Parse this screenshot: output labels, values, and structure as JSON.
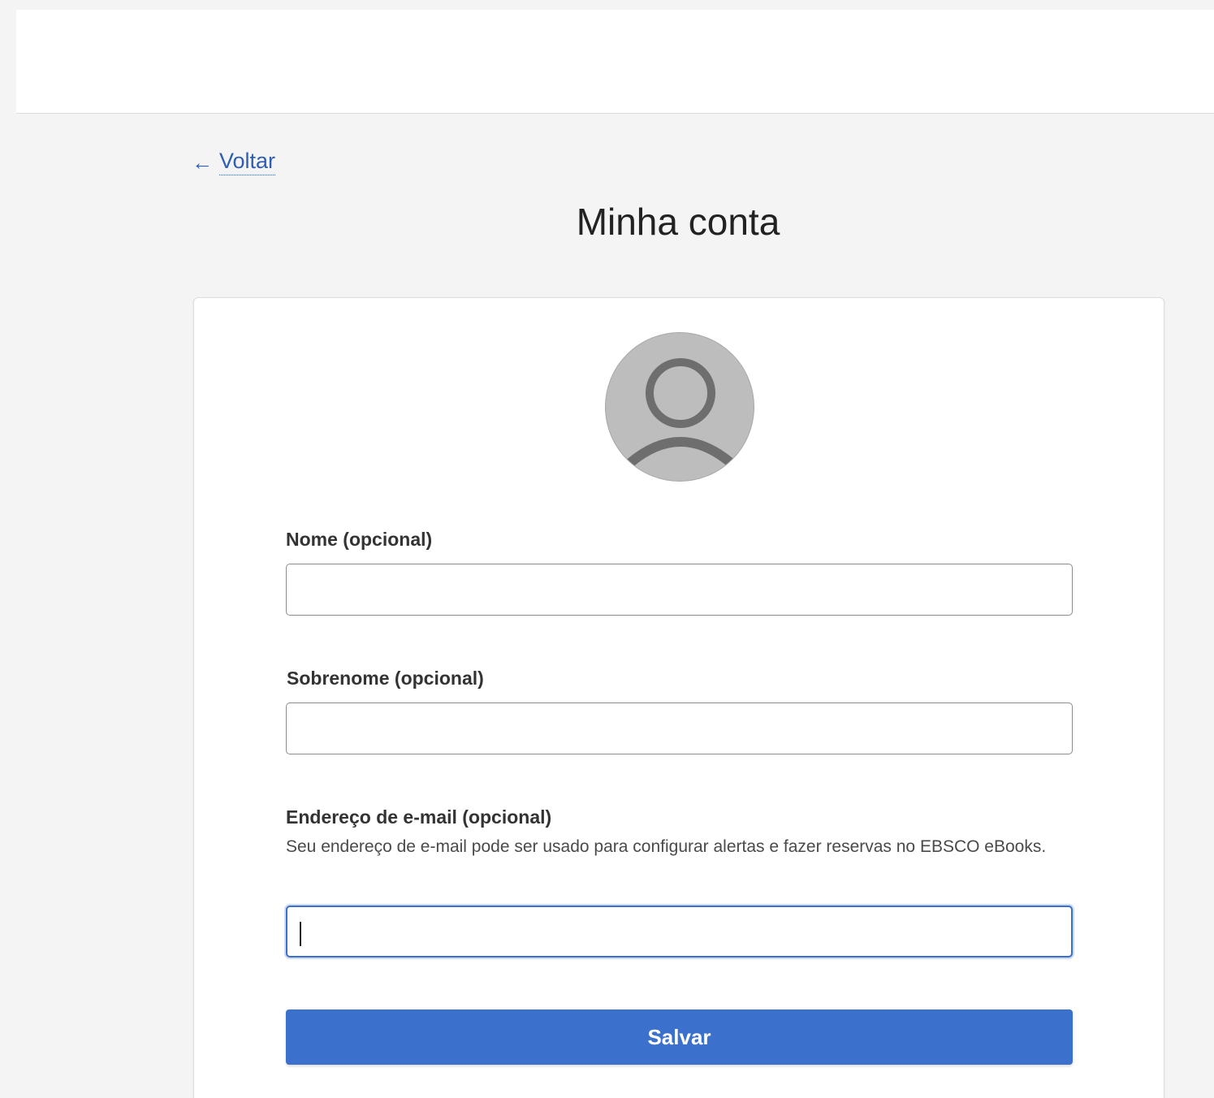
{
  "nav": {
    "back_label": "Voltar",
    "back_arrow": "←"
  },
  "page_title": "Minha conta",
  "avatar": {
    "icon": "user-profile-icon"
  },
  "form": {
    "first_name": {
      "label": "Nome (opcional)",
      "value": ""
    },
    "last_name": {
      "label": "Sobrenome (opcional)",
      "value": ""
    },
    "email": {
      "label": "Endereço de e-mail (opcional)",
      "help": "Seu endereço de e-mail pode ser usado para configurar alertas e fazer reservas no EBSCO eBooks.",
      "value": "",
      "focused": true
    },
    "save_label": "Salvar"
  },
  "colors": {
    "accent": "#3b70cc",
    "link": "#2f5fb3",
    "background": "#f4f4f4",
    "avatar_bg": "#bdbdbd",
    "avatar_fg": "#6e6e6e"
  }
}
